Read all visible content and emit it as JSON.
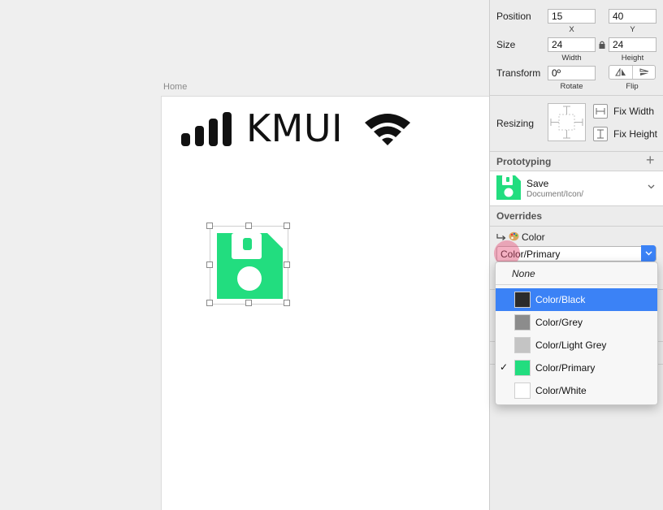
{
  "artboard": {
    "title": "Home",
    "brand_text": "KMUI"
  },
  "inspector": {
    "position": {
      "label": "Position",
      "x": "15",
      "y": "40",
      "x_label": "X",
      "y_label": "Y"
    },
    "size": {
      "label": "Size",
      "width": "24",
      "height": "24",
      "width_label": "Width",
      "height_label": "Height"
    },
    "transform": {
      "label": "Transform",
      "rotate": "0º",
      "rotate_label": "Rotate",
      "flip_label": "Flip"
    },
    "resizing": {
      "label": "Resizing",
      "fix_width": "Fix Width",
      "fix_height": "Fix Height"
    },
    "prototyping": {
      "label": "Prototyping"
    },
    "symbol": {
      "name": "Save",
      "path": "Document/Icon/"
    },
    "overrides": {
      "label": "Overrides",
      "item_label": "Color",
      "selected_value": "Color/Primary"
    }
  },
  "menu": {
    "none_label": "None",
    "items": [
      {
        "label": "Color/Black",
        "color": "#2b2b2b",
        "active": true,
        "checked": false
      },
      {
        "label": "Color/Grey",
        "color": "#8c8c8c",
        "active": false,
        "checked": false
      },
      {
        "label": "Color/Light Grey",
        "color": "#c4c4c4",
        "active": false,
        "checked": false
      },
      {
        "label": "Color/Primary",
        "color": "#22dd7f",
        "active": false,
        "checked": true
      },
      {
        "label": "Color/White",
        "color": "#ffffff",
        "active": false,
        "checked": false
      }
    ],
    "check_glyph": "✓"
  },
  "colors": {
    "primary": "#22dd7f",
    "accent": "#3b82f6"
  }
}
